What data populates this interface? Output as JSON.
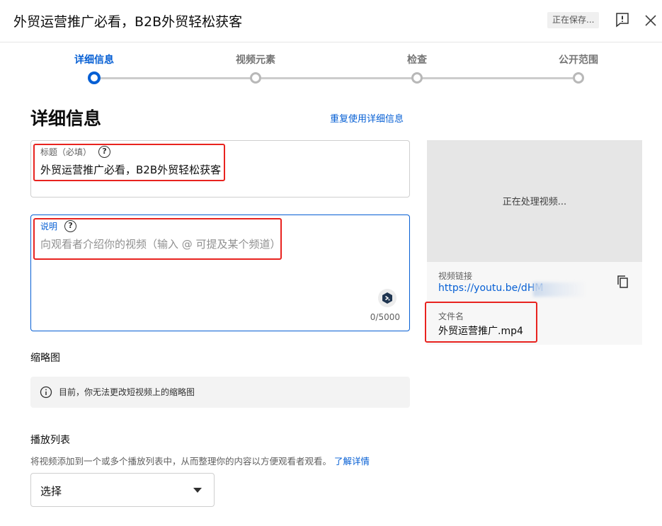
{
  "header": {
    "title": "外贸运营推广必看，B2B外贸轻松获客",
    "saving_status": "正在保存...",
    "feedback_icon": "feedback-icon",
    "close_icon": "close-icon"
  },
  "stepper": {
    "steps": [
      {
        "label": "详细信息",
        "active": true
      },
      {
        "label": "视频元素",
        "active": false
      },
      {
        "label": "检查",
        "active": false
      },
      {
        "label": "公开范围",
        "active": false
      }
    ]
  },
  "details": {
    "heading": "详细信息",
    "reuse_link": "重复使用详细信息",
    "title_field": {
      "label": "标题（必填）",
      "help": "?",
      "value": "外贸运营推广必看，B2B外贸轻松获客"
    },
    "description_field": {
      "label": "说明",
      "help": "?",
      "placeholder": "向观看者介绍你的视频（输入 @ 可提及某个频道）",
      "char_count": "0/5000"
    },
    "thumbnail": {
      "heading": "缩略图",
      "info": "目前，你无法更改短视频上的缩略图"
    },
    "playlist": {
      "heading": "播放列表",
      "description": "将视频添加到一个或多个播放列表中，从而整理你的内容以方便观看者观看。",
      "learn_more": "了解详情",
      "select_value": "选择"
    }
  },
  "preview": {
    "processing": "正在处理视频...",
    "link_label": "视频链接",
    "link": "https://youtu.be/dHM",
    "filename_label": "文件名",
    "filename": "外贸运营推广.mp4"
  },
  "colors": {
    "accent": "#065fd4",
    "highlight": "#e8231f"
  }
}
